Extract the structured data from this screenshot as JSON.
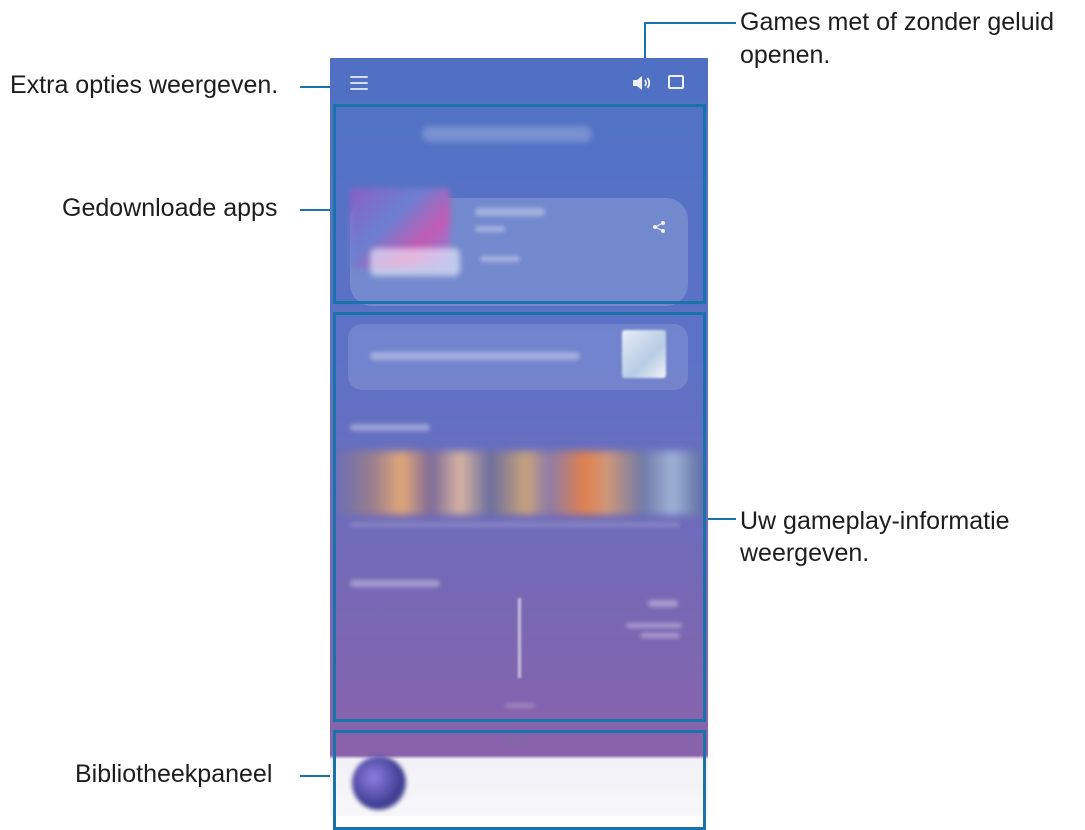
{
  "callouts": {
    "extra_options": "Extra opties weergeven.",
    "sound_line1": "Games met of zonder geluid",
    "sound_line2": "openen.",
    "downloaded_apps": "Gedownloade apps",
    "gameplay_line1": "Uw gameplay-informatie",
    "gameplay_line2": "weergeven.",
    "library_panel": "Bibliotheekpaneel"
  },
  "icons": {
    "menu": "hamburger-icon",
    "sound": "sound-icon",
    "window": "square-icon",
    "share": "share-icon"
  },
  "colors": {
    "header": "#4f70c3",
    "frame": "#1a73a8",
    "gradient_top": "#4f72c4",
    "gradient_bottom": "#8a62ab"
  }
}
